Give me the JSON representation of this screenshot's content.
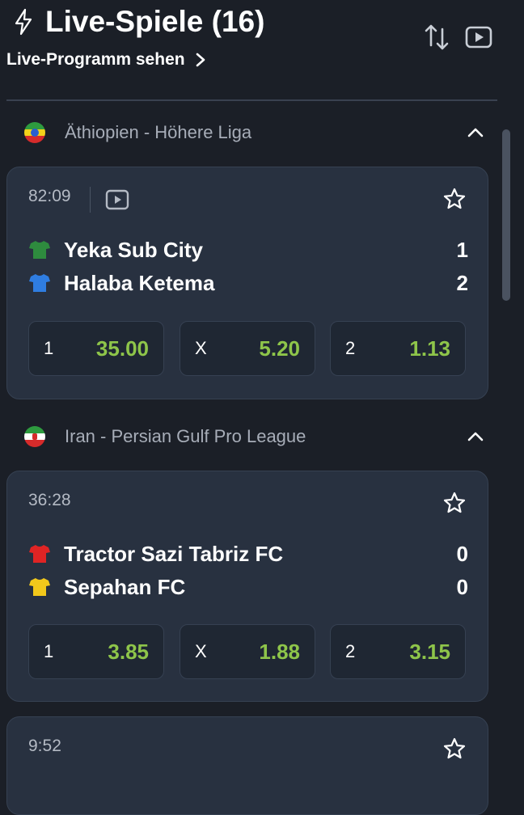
{
  "header": {
    "title": "Live-Spiele (16)",
    "live_program_link": "Live-Programm sehen"
  },
  "icons": {
    "title_icon": "lightning-bolt-icon",
    "sort": "sort-arrows-icon",
    "video": "video-play-icon",
    "favorite": "star-outline-icon",
    "collapse": "chevron-up-icon",
    "link": "chevron-right-icon"
  },
  "colors": {
    "background": "#1b1f27",
    "card": "#283140",
    "odds_value": "#8ec54a",
    "secondary_text": "#a7adb8"
  },
  "leagues": [
    {
      "name": "Äthiopien - Höhere Liga",
      "flag": "ethiopia",
      "matches": [
        {
          "time": "82:09",
          "has_stream": true,
          "home": {
            "name": "Yeka Sub City",
            "score": "1",
            "shirt_color": "#2e8b3e"
          },
          "away": {
            "name": "Halaba Ketema",
            "score": "2",
            "shirt_color": "#2f7de1"
          },
          "odds": [
            {
              "label": "1",
              "value": "35.00"
            },
            {
              "label": "X",
              "value": "5.20"
            },
            {
              "label": "2",
              "value": "1.13"
            }
          ]
        }
      ]
    },
    {
      "name": "Iran - Persian Gulf Pro League",
      "flag": "iran",
      "matches": [
        {
          "time": "36:28",
          "has_stream": false,
          "home": {
            "name": "Tractor Sazi Tabriz FC",
            "score": "0",
            "shirt_color": "#e02424"
          },
          "away": {
            "name": "Sepahan FC",
            "score": "0",
            "shirt_color": "#f2c81b"
          },
          "odds": [
            {
              "label": "1",
              "value": "3.85"
            },
            {
              "label": "X",
              "value": "1.88"
            },
            {
              "label": "2",
              "value": "3.15"
            }
          ]
        },
        {
          "time": "9:52",
          "has_stream": false
        }
      ]
    }
  ]
}
